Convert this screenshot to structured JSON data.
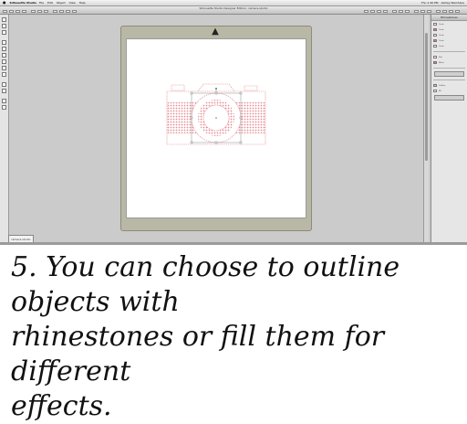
{
  "menubar": {
    "app_name": "Silhouette Studio",
    "items": [
      "File",
      "Edit",
      "Object",
      "View",
      "Help"
    ],
    "right_items": [
      "Thu 1:40 PM",
      "Ashley Weinhaus"
    ]
  },
  "window": {
    "title": "Silhouette Studio Designer Edition: camera.studio"
  },
  "panel": {
    "title": "Rhinestones",
    "rows": [
      "Circle",
      "Circle",
      "Circle",
      "Circle",
      "Circle",
      "Flat",
      "Effect",
      "Outline",
      "Fill"
    ]
  },
  "document_tab": {
    "label": "camera.studio"
  },
  "caption": {
    "line1": "5. You can choose to outline objects with",
    "line2": "rhinestones or fill them for different",
    "line3": "effects."
  },
  "colors": {
    "rhinestone": "#e07a82",
    "mat": "#b9b7a5",
    "canvas_bg": "#cbcbcb"
  },
  "icons": {
    "scroll_up": "arrow-up-icon"
  }
}
